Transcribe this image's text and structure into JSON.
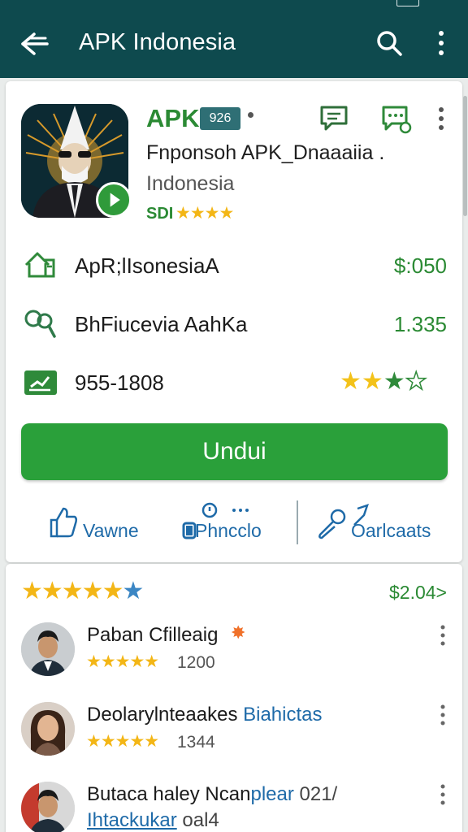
{
  "appbar": {
    "title": "APK Indonesia"
  },
  "app": {
    "name": "APK",
    "version_badge": "926",
    "subtitle": "Fnponsoh APK_Dnaaaiia .",
    "subtitle2": "Indonesia",
    "rating_code": "SDI",
    "rating_stars": "★★★★"
  },
  "info_rows": [
    {
      "label": "ApR;lIsonesiaA",
      "value": "$:050",
      "icon": "home-icon"
    },
    {
      "label": "BhFiucevia  AahKa",
      "value": "1.335",
      "icon": "search-person-icon"
    },
    {
      "label": "955-1808",
      "value": "",
      "icon": "chart-badge-icon",
      "stars": "3.5 of 4"
    }
  ],
  "download_button": "Undui",
  "actions": [
    {
      "label": "Vawne",
      "icon": "like-icon"
    },
    {
      "label": "Phncclo",
      "icon": "controller-icon"
    },
    {
      "label": "Oarlcaats",
      "icon": "edit-icon"
    }
  ],
  "summary": {
    "stars": "★★★★★",
    "price": "$2.04>"
  },
  "reviews": [
    {
      "name": "Paban Cfilleaig",
      "name_extra": "",
      "stars": "★★★★★",
      "count": "1200"
    },
    {
      "name": "Deolarylnteaakes",
      "name_extra": "Biahictas",
      "stars": "★★★★★",
      "count": "1344"
    },
    {
      "name": "Butaca haley Ncan",
      "name_extra": "plear",
      "name_tail": "021/",
      "line2": "Ihtackukar",
      "count": "oal4"
    }
  ],
  "colors": {
    "appbar": "#0e4a4e",
    "accent_green": "#2aa03a",
    "link_blue": "#1e6aa8",
    "star_yellow": "#f3b616"
  }
}
